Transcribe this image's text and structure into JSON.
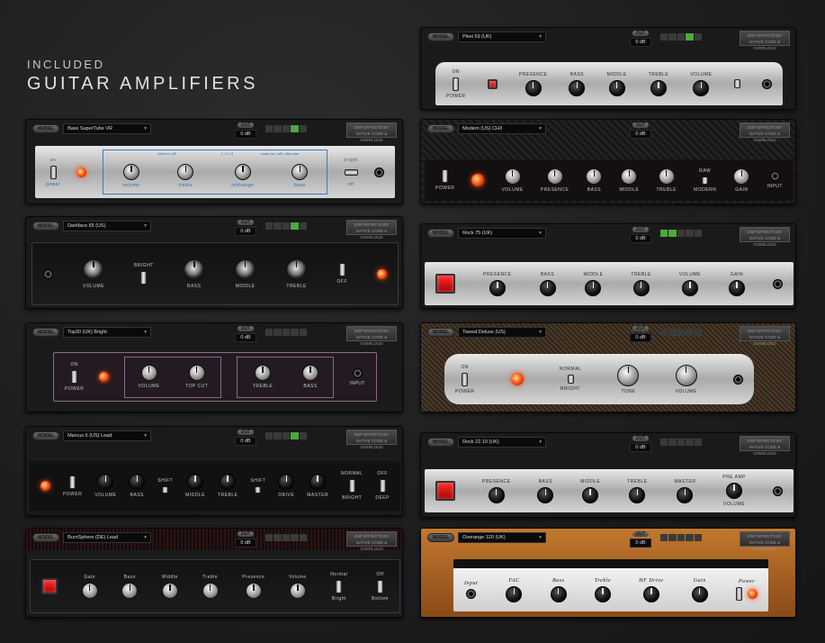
{
  "heading": {
    "sub": "INCLUDED",
    "main": "GUITAR AMPLIFIERS"
  },
  "common": {
    "model_label": "MODEL",
    "out_label": "OUT",
    "db_value": "0 dB",
    "dsp_line1": "DSP EFFECTS BY",
    "dsp_line2": "NATIVE CODE & OVERLOUD"
  },
  "amps": [
    {
      "id": "plexi",
      "model": "Plexi 59 (UK)",
      "controls": [
        "ON",
        "POWER",
        "PRESENCE",
        "BASS",
        "MIDDLE",
        "TREBLE",
        "VOLUME"
      ]
    },
    {
      "id": "bass",
      "model": "Bass SuperTube VR",
      "controls": [
        "on",
        "power",
        "volume",
        "treble",
        "midrange",
        "bass",
        "bright",
        "off",
        "ultra-hi • off",
        "1 • 2 • 3",
        "bass cut • off • ultra-low"
      ]
    },
    {
      "id": "modern",
      "model": "Modern (US) CH3",
      "controls": [
        "POWER",
        "VOLUME",
        "PRESENCE",
        "BASS",
        "MIDDLE",
        "TREBLE",
        "RAW",
        "MODERN",
        "GAIN",
        "INPUT"
      ]
    },
    {
      "id": "darkface",
      "model": "Darkface 65 (US)",
      "controls": [
        "VOLUME",
        "BRIGHT",
        "BASS",
        "MIDDLE",
        "TREBLE",
        "OFF"
      ]
    },
    {
      "id": "rock75",
      "model": "Rock 75 (UK)",
      "controls": [
        "PRESENCE",
        "BASS",
        "MIDDLE",
        "TREBLE",
        "VOLUME",
        "GAIN"
      ]
    },
    {
      "id": "top30",
      "model": "Top30 (UK) Bright",
      "controls": [
        "ON",
        "POWER",
        "VOLUME",
        "TOP CUT",
        "TREBLE",
        "BASS",
        "INPUT"
      ]
    },
    {
      "id": "tweed",
      "model": "Tweed Deluxe (US)",
      "controls": [
        "ON",
        "POWER",
        "NORMAL",
        "BRIGHT",
        "TONE",
        "VOLUME"
      ]
    },
    {
      "id": "marcus",
      "model": "Marcus 6 (US) Lead",
      "controls": [
        "POWER",
        "VOLUME",
        "BASS",
        "SHIFT",
        "MIDDLE",
        "TREBLE",
        "SHIFT",
        "DRIVE",
        "MASTER",
        "NORMAL",
        "BRIGHT",
        "OFF",
        "DEEP"
      ]
    },
    {
      "id": "rock2210",
      "model": "Rock 22.10 (UK)",
      "controls": [
        "PRESENCE",
        "BASS",
        "MIDDLE",
        "TREBLE",
        "MASTER",
        "PRE AMP",
        "VOLUME"
      ]
    },
    {
      "id": "burnsphere",
      "model": "BurnSphere (DE) Lead",
      "controls": [
        "Gain",
        "Bass",
        "Middle",
        "Treble",
        "Presence",
        "Volume",
        "Normal",
        "Bright",
        "Off",
        "Bottom"
      ]
    },
    {
      "id": "overange",
      "model": "Overange 120 (UK)",
      "controls": [
        "Input",
        "FAC",
        "Bass",
        "Treble",
        "HF Drive",
        "Gain",
        "Power"
      ]
    }
  ]
}
